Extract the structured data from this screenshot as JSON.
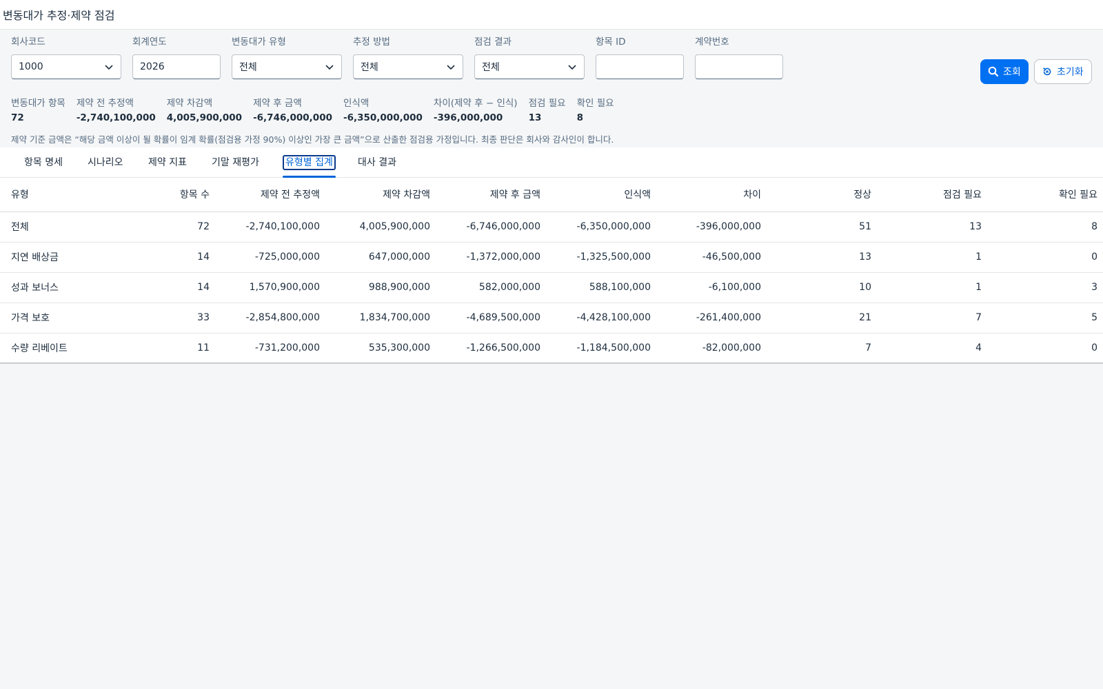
{
  "app": {
    "title": "변동대가 추정·제약 점검"
  },
  "filters": {
    "company_code": {
      "label": "회사코드",
      "value": "1000"
    },
    "fiscal_year": {
      "label": "회계연도",
      "value": "2026"
    },
    "vc_type": {
      "label": "변동대가 유형",
      "value": "전체"
    },
    "estimation_method": {
      "label": "추정 방법",
      "value": "전체"
    },
    "check_result": {
      "label": "점검 결과",
      "value": "전체"
    },
    "item_id": {
      "label": "항목 ID",
      "value": ""
    },
    "contract_no": {
      "label": "계약번호",
      "value": ""
    },
    "search_label": "조회",
    "reset_label": "초기화"
  },
  "kpis": [
    {
      "label": "변동대가 항목",
      "value": "72"
    },
    {
      "label": "제약 전 추정액",
      "value": "-2,740,100,000"
    },
    {
      "label": "제약 차감액",
      "value": "4,005,900,000"
    },
    {
      "label": "제약 후 금액",
      "value": "-6,746,000,000"
    },
    {
      "label": "인식액",
      "value": "-6,350,000,000"
    },
    {
      "label": "차이(제약 후 − 인식)",
      "value": "-396,000,000"
    },
    {
      "label": "점검 필요",
      "value": "13"
    },
    {
      "label": "확인 필요",
      "value": "8"
    }
  ],
  "note": "제약 기준 금액은 “해당 금액 이상이 될 확률이 임계 확률(점검용 가정 90%) 이상인 가장 큰 금액”으로 산출한 점검용 가정입니다. 최종 판단은 회사와 감사인이 합니다.",
  "tabs": [
    {
      "label": "항목 명세"
    },
    {
      "label": "시나리오"
    },
    {
      "label": "제약 지표"
    },
    {
      "label": "기말 재평가"
    },
    {
      "label": "유형별 집계"
    },
    {
      "label": "대사 결과"
    }
  ],
  "table": {
    "headers": [
      "유형",
      "항목 수",
      "제약 전 추정액",
      "제약 차감액",
      "제약 후 금액",
      "인식액",
      "차이",
      "정상",
      "점검 필요",
      "확인 필요"
    ],
    "rows": [
      [
        "전체",
        "72",
        "-2,740,100,000",
        "4,005,900,000",
        "-6,746,000,000",
        "-6,350,000,000",
        "-396,000,000",
        "51",
        "13",
        "8"
      ],
      [
        "지연 배상금",
        "14",
        "-725,000,000",
        "647,000,000",
        "-1,372,000,000",
        "-1,325,500,000",
        "-46,500,000",
        "13",
        "1",
        "0"
      ],
      [
        "성과 보너스",
        "14",
        "1,570,900,000",
        "988,900,000",
        "582,000,000",
        "588,100,000",
        "-6,100,000",
        "10",
        "1",
        "3"
      ],
      [
        "가격 보호",
        "33",
        "-2,854,800,000",
        "1,834,700,000",
        "-4,689,500,000",
        "-4,428,100,000",
        "-261,400,000",
        "21",
        "7",
        "5"
      ],
      [
        "수량 리베이트",
        "11",
        "-731,200,000",
        "535,300,000",
        "-1,266,500,000",
        "-1,184,500,000",
        "-82,000,000",
        "7",
        "4",
        "0"
      ]
    ]
  }
}
